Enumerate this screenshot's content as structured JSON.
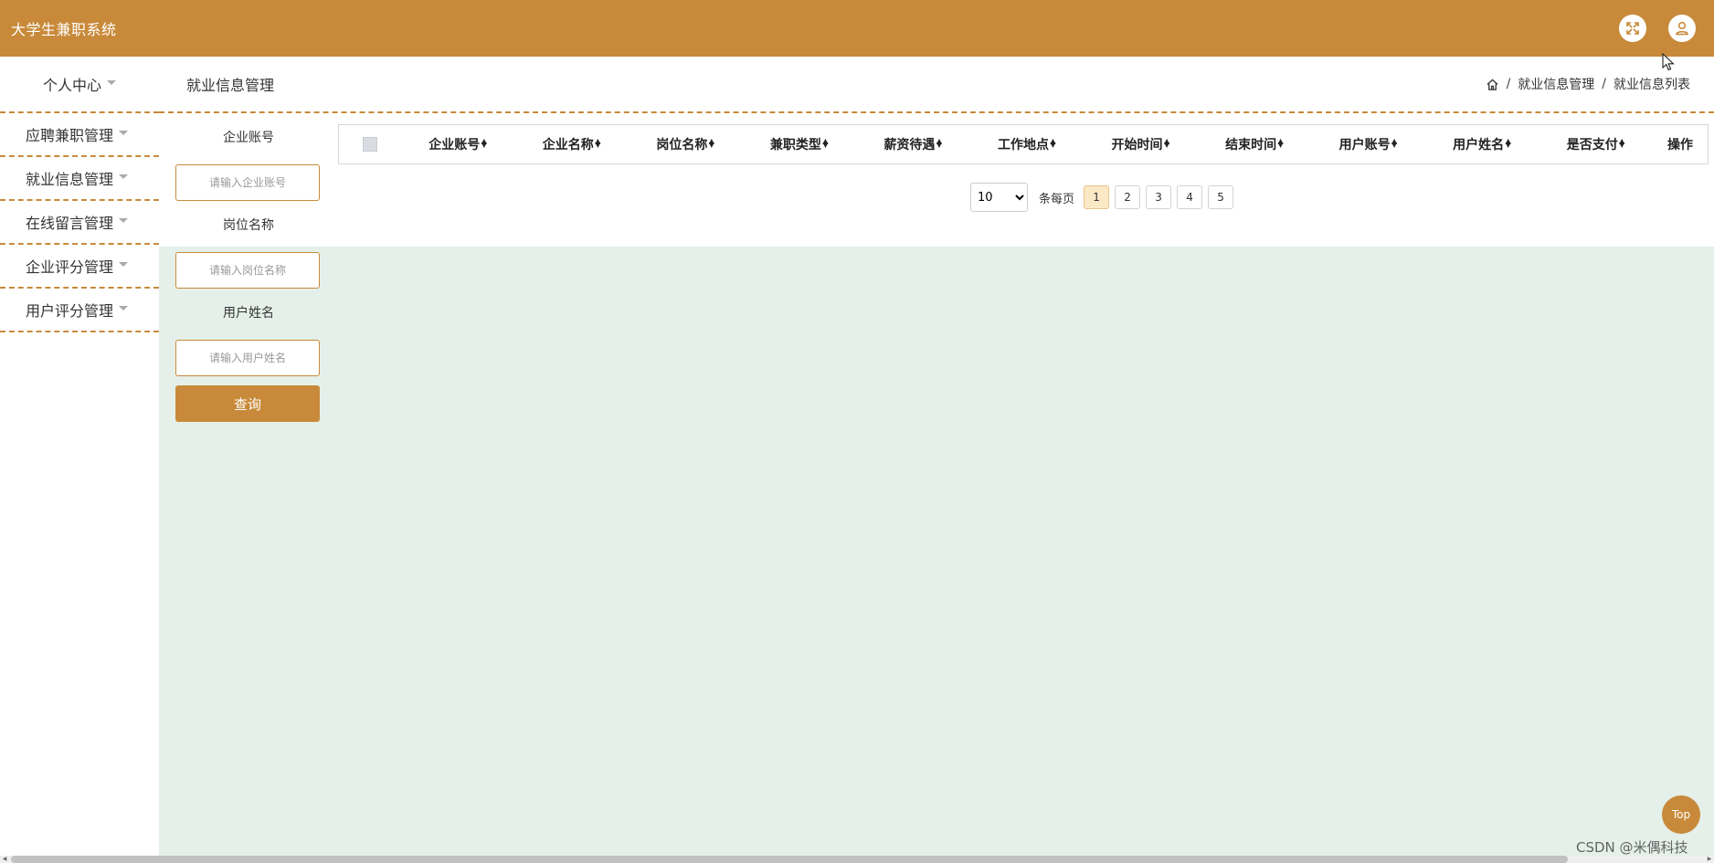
{
  "header": {
    "title": "大学生兼职系统",
    "fullscreen_icon": "fullscreen-icon",
    "user_icon": "user-icon"
  },
  "sidebar": {
    "items": [
      {
        "label": "个人中心"
      },
      {
        "label": "应聘兼职管理"
      },
      {
        "label": "就业信息管理"
      },
      {
        "label": "在线留言管理"
      },
      {
        "label": "企业评分管理"
      },
      {
        "label": "用户评分管理"
      }
    ]
  },
  "content": {
    "page_title": "就业信息管理",
    "breadcrumb": {
      "home_icon": "home-icon",
      "separator": "/",
      "items": [
        "就业信息管理",
        "就业信息列表"
      ]
    }
  },
  "search": {
    "fields": [
      {
        "label": "企业账号",
        "placeholder": "请输入企业账号",
        "value": ""
      },
      {
        "label": "岗位名称",
        "placeholder": "请输入岗位名称",
        "value": ""
      },
      {
        "label": "用户姓名",
        "placeholder": "请输入用户姓名",
        "value": ""
      }
    ],
    "query_label": "查询"
  },
  "table": {
    "columns": [
      "企业账号",
      "企业名称",
      "岗位名称",
      "兼职类型",
      "薪资待遇",
      "工作地点",
      "开始时间",
      "结束时间",
      "用户账号",
      "用户姓名",
      "是否支付"
    ],
    "action_column": "操作",
    "rows": []
  },
  "pagination": {
    "page_size": "10",
    "page_size_options": [
      "10"
    ],
    "per_page_label": "条每页",
    "pages": [
      "1",
      "2",
      "3",
      "4",
      "5"
    ],
    "current_page": "1"
  },
  "top_button_label": "Top",
  "watermark": "CSDN @米偶科技",
  "colors": {
    "accent": "#c88a3a",
    "main_background": "#e4f0e9",
    "active_page": "#fbe8c5"
  }
}
